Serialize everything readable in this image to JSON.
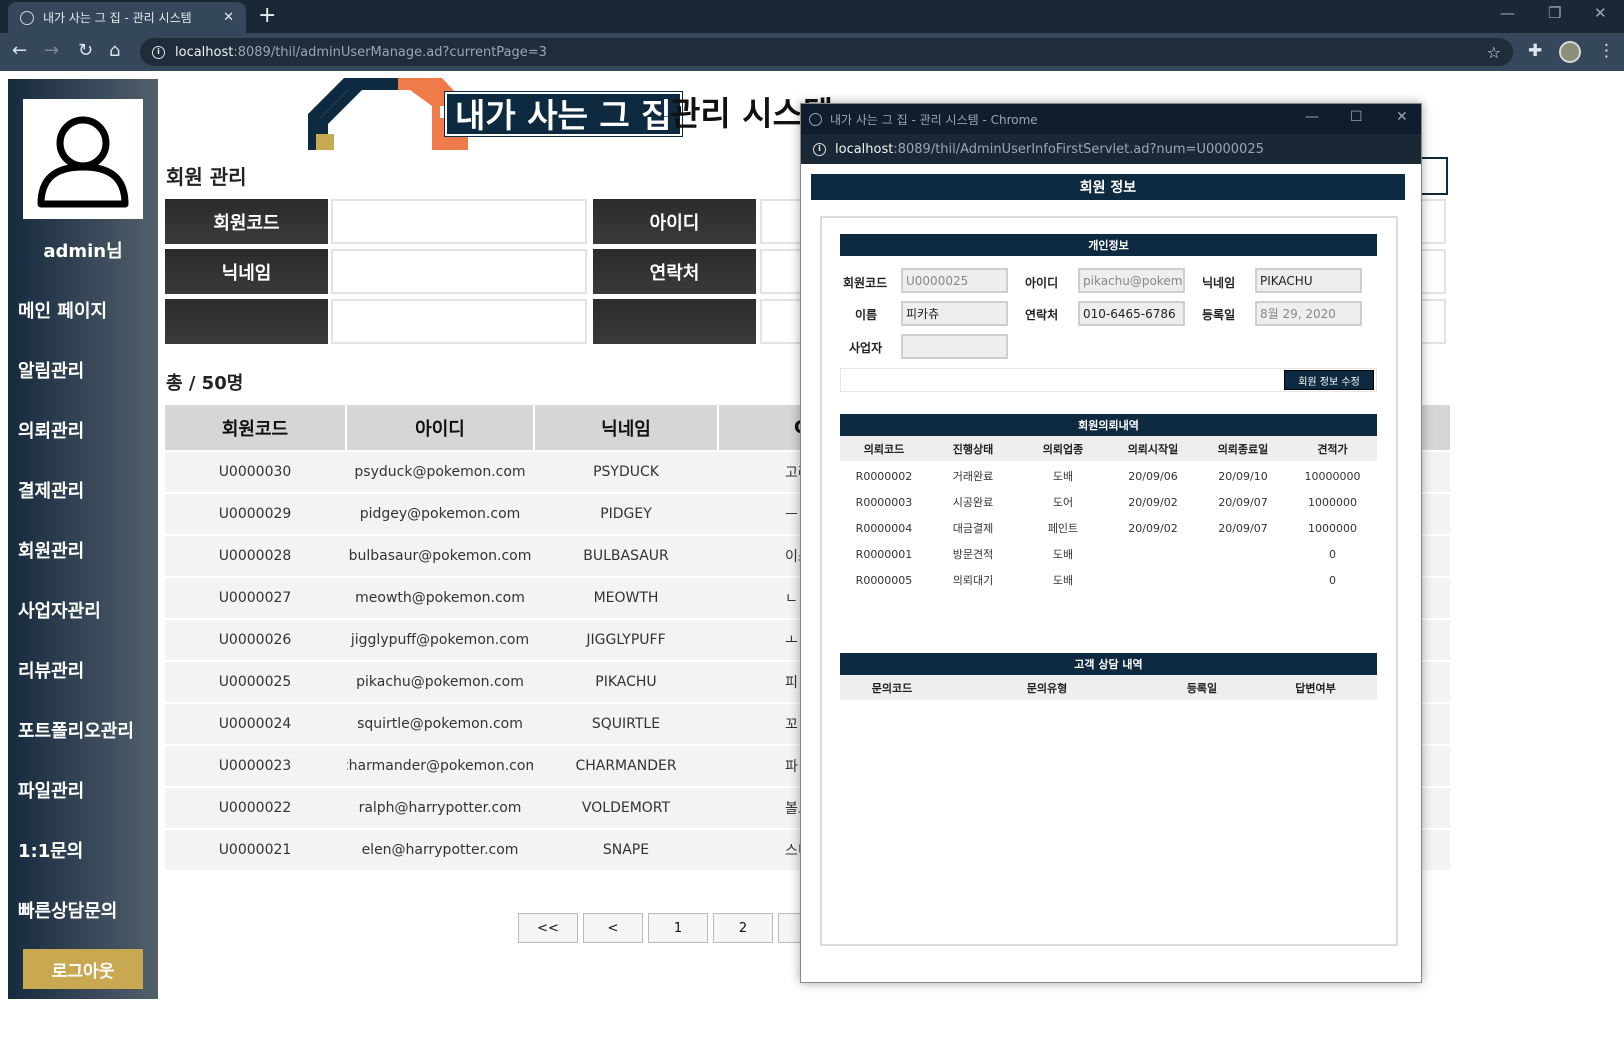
{
  "browser": {
    "tab_title": "내가 사는 그 집 - 관리 시스템",
    "url_host": "localhost",
    "url_rest": ":8089/thil/adminUserManage.ad?currentPage=3"
  },
  "sidebar": {
    "user_label": "admin님",
    "items": [
      {
        "label": "메인 페이지"
      },
      {
        "label": "알림관리"
      },
      {
        "label": "의뢰관리"
      },
      {
        "label": "결제관리"
      },
      {
        "label": "회원관리"
      },
      {
        "label": "사업자관리"
      },
      {
        "label": "리뷰관리"
      },
      {
        "label": "포트폴리오관리"
      },
      {
        "label": "파일관리"
      },
      {
        "label": "1:1문의"
      },
      {
        "label": "빠른상담문의"
      }
    ],
    "logout_label": "로그아웃"
  },
  "brand": {
    "highlight": "내가 사는 그 집",
    "rest": "관리 시스템"
  },
  "page": {
    "title": "회원 관리",
    "search_labels": [
      "회원코드",
      "아이디",
      "닉네임",
      "연락처"
    ],
    "total": "총 / 50명"
  },
  "table": {
    "headers": [
      "회원코드",
      "아이디",
      "닉네임",
      "C"
    ],
    "rows": [
      [
        "U0000030",
        "psyduck@pokemon.com",
        "PSYDUCK",
        "고라"
      ],
      [
        "U0000029",
        "pidgey@pokemon.com",
        "PIDGEY",
        "ㅡ"
      ],
      [
        "U0000028",
        "bulbasaur@pokemon.com",
        "BULBASAUR",
        "이스"
      ],
      [
        "U0000027",
        "meowth@pokemon.com",
        "MEOWTH",
        "ㄴ"
      ],
      [
        "U0000026",
        "jigglypuff@pokemon.com",
        "JIGGLYPUFF",
        "ㅗ"
      ],
      [
        "U0000025",
        "pikachu@pokemon.com",
        "PIKACHU",
        "피"
      ],
      [
        "U0000024",
        "squirtle@pokemon.com",
        "SQUIRTLE",
        "꼬"
      ],
      [
        "U0000023",
        "charmander@pokemon.com",
        "CHARMANDER",
        "파"
      ],
      [
        "U0000022",
        "ralph@harrypotter.com",
        "VOLDEMORT",
        "볼드"
      ],
      [
        "U0000021",
        "elen@harrypotter.com",
        "SNAPE",
        "스니"
      ]
    ]
  },
  "pagination": [
    "<<",
    "<",
    "1",
    "2"
  ],
  "popup": {
    "window_title": "내가 사는 그 집 - 관리 시스템 - Chrome",
    "url_host": "localhost",
    "url_rest": ":8089/thil/AdminUserInfoFirstServlet.ad?num=U0000025",
    "header": "회원 정보",
    "personal_section": "개인정보",
    "fields": {
      "code_label": "회원코드",
      "code_value": "U0000025",
      "id_label": "아이디",
      "id_value": "pikachu@pokem",
      "nick_label": "닉네임",
      "nick_value": "PIKACHU",
      "name_label": "이름",
      "name_value": "피카츄",
      "phone_label": "연락처",
      "phone_value": "010-6465-6786",
      "date_label": "등록일",
      "date_value": "8월 29, 2020",
      "biz_label": "사업자",
      "biz_value": ""
    },
    "edit_button": "회원 정보 수정",
    "request_section": "회원의뢰내역",
    "request_headers": [
      "의뢰코드",
      "진행상태",
      "의뢰업종",
      "의뢰시작일",
      "의뢰종료일",
      "견적가"
    ],
    "requests": [
      [
        "R0000002",
        "거래완료",
        "도배",
        "20/09/06",
        "20/09/10",
        "10000000"
      ],
      [
        "R0000003",
        "시공완료",
        "도어",
        "20/09/02",
        "20/09/07",
        "1000000"
      ],
      [
        "R0000004",
        "대금결제",
        "페인트",
        "20/09/02",
        "20/09/07",
        "1000000"
      ],
      [
        "R0000001",
        "방문견적",
        "도배",
        "",
        "",
        "0"
      ],
      [
        "R0000005",
        "의뢰대기",
        "도배",
        "",
        "",
        "0"
      ]
    ],
    "consult_section": "고객 상담 내역",
    "consult_headers": [
      "문의코드",
      "문의유형",
      "등록일",
      "답변여부"
    ]
  }
}
